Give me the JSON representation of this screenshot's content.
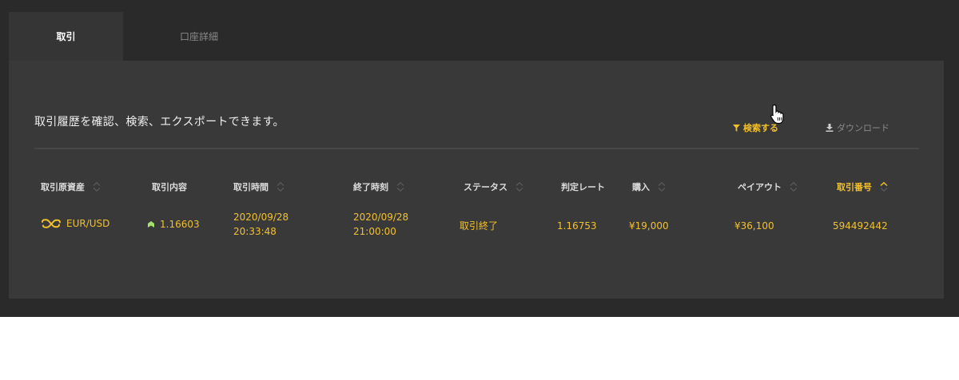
{
  "tabs": [
    {
      "label": "取引",
      "active": true
    },
    {
      "label": "口座詳細",
      "active": false
    }
  ],
  "description": "取引履歴を確認、検索、エクスポートできます。",
  "toolbar": {
    "search_label": "検索する",
    "download_label": "ダウンロード"
  },
  "table": {
    "headers": [
      {
        "label": "取引原資産",
        "sortable": true
      },
      {
        "label": "取引内容",
        "sortable": false
      },
      {
        "label": "取引時間",
        "sortable": true
      },
      {
        "label": "終了時刻",
        "sortable": true
      },
      {
        "label": "ステータス",
        "sortable": true
      },
      {
        "label": "判定レート",
        "sortable": false
      },
      {
        "label": "購入",
        "sortable": true
      },
      {
        "label": "ペイアウト",
        "sortable": true
      },
      {
        "label": "取引番号",
        "sortable": true,
        "sorted": "asc"
      }
    ],
    "rows": [
      {
        "asset": "EUR/USD",
        "trade_rate": "1.16603",
        "direction": "up",
        "trade_time_date": "2020/09/28",
        "trade_time_clock": "20:33:48",
        "end_time_date": "2020/09/28",
        "end_time_clock": "21:00:00",
        "status": "取引終了",
        "judge_rate": "1.16753",
        "purchase": "¥19,000",
        "payout": "¥36,100",
        "trade_id": "594492442"
      }
    ]
  },
  "colors": {
    "accent": "#f2c12e",
    "up": "#a6e36b",
    "background": "#2a2a2a",
    "panel": "#393939",
    "active_tab": "#353535"
  }
}
